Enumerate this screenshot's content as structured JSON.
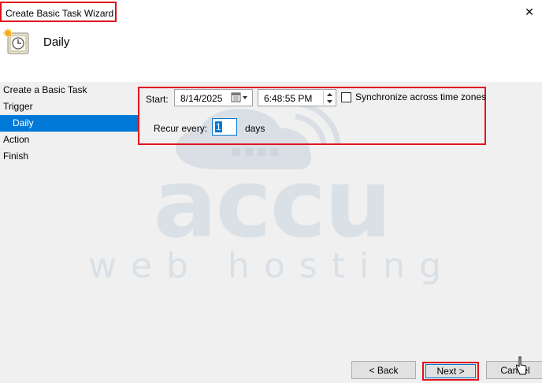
{
  "window": {
    "title": "Create Basic Task Wizard",
    "close_glyph": "✕"
  },
  "header": {
    "title": "Daily",
    "icon": "task-clock-icon"
  },
  "nav": {
    "items": [
      {
        "label": "Create a Basic Task",
        "sub": false,
        "active": false
      },
      {
        "label": "Trigger",
        "sub": false,
        "active": false
      },
      {
        "label": "Daily",
        "sub": true,
        "active": true
      },
      {
        "label": "Action",
        "sub": false,
        "active": false
      },
      {
        "label": "Finish",
        "sub": false,
        "active": false
      }
    ]
  },
  "schedule": {
    "start_label": "Start:",
    "start_date": "8/14/2025",
    "start_time": "6:48:55 PM",
    "sync_label": "Synchronize across time zones",
    "sync_checked": false,
    "recur_label": "Recur every:",
    "recur_value": "1",
    "recur_unit": "days"
  },
  "watermark": {
    "line1": "accu",
    "line2": "web hosting"
  },
  "buttons": {
    "back": "< Back",
    "next": "Next >",
    "cancel": "Cancel"
  },
  "colors": {
    "accent": "#0078d7",
    "highlight": "#e0141e",
    "watermark": "#d4dde5"
  }
}
